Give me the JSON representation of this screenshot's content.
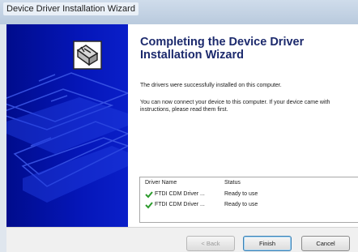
{
  "window": {
    "title": "Device Driver Installation Wizard"
  },
  "main": {
    "heading": "Completing the Device Driver Installation Wizard",
    "paragraph1": "The drivers were successfully installed on this computer.",
    "paragraph2": "You can now connect your device to this computer. If your device came with instructions, please read them first."
  },
  "driver_table": {
    "columns": [
      "Driver Name",
      "Status"
    ],
    "rows": [
      {
        "name": "FTDI CDM Driver ...",
        "status": "Ready to use",
        "icon": "green-check-icon"
      },
      {
        "name": "FTDI CDM Driver ...",
        "status": "Ready to use",
        "icon": "green-check-icon"
      }
    ]
  },
  "buttons": {
    "back": "< Back",
    "finish": "Finish",
    "cancel": "Cancel"
  },
  "colors": {
    "sidebar": "#0516b8",
    "heading": "#1c2a6d",
    "check": "#2c9a2c"
  }
}
